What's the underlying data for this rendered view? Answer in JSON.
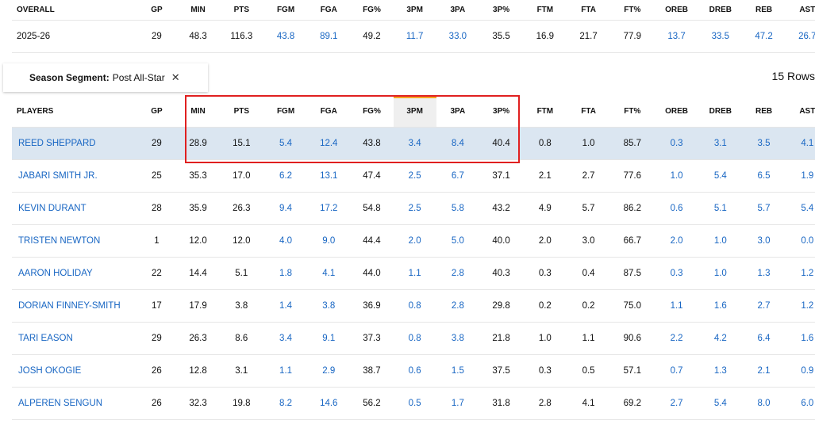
{
  "summary": {
    "headers": [
      "OVERALL",
      "GP",
      "MIN",
      "PTS",
      "FGM",
      "FGA",
      "FG%",
      "3PM",
      "3PA",
      "3P%",
      "FTM",
      "FTA",
      "FT%",
      "OREB",
      "DREB",
      "REB",
      "AST"
    ],
    "row": [
      "2025-26",
      "29",
      "48.3",
      "116.3",
      "43.8",
      "89.1",
      "49.2",
      "11.7",
      "33.0",
      "35.5",
      "16.9",
      "21.7",
      "77.9",
      "13.7",
      "33.5",
      "47.2",
      "26.7"
    ]
  },
  "segment": {
    "label": "Season Segment:",
    "value": "Post All-Star",
    "close": "✕"
  },
  "row_count": "15 Rows",
  "players": {
    "headers": [
      "PLAYERS",
      "GP",
      "MIN",
      "PTS",
      "FGM",
      "FGA",
      "FG%",
      "3PM",
      "3PA",
      "3P%",
      "FTM",
      "FTA",
      "FT%",
      "OREB",
      "DREB",
      "REB",
      "AST"
    ],
    "rows": [
      [
        "REED SHEPPARD",
        "29",
        "28.9",
        "15.1",
        "5.4",
        "12.4",
        "43.8",
        "3.4",
        "8.4",
        "40.4",
        "0.8",
        "1.0",
        "85.7",
        "0.3",
        "3.1",
        "3.5",
        "4.1"
      ],
      [
        "JABARI SMITH JR.",
        "25",
        "35.3",
        "17.0",
        "6.2",
        "13.1",
        "47.4",
        "2.5",
        "6.7",
        "37.1",
        "2.1",
        "2.7",
        "77.6",
        "1.0",
        "5.4",
        "6.5",
        "1.9"
      ],
      [
        "KEVIN DURANT",
        "28",
        "35.9",
        "26.3",
        "9.4",
        "17.2",
        "54.8",
        "2.5",
        "5.8",
        "43.2",
        "4.9",
        "5.7",
        "86.2",
        "0.6",
        "5.1",
        "5.7",
        "5.4"
      ],
      [
        "TRISTEN NEWTON",
        "1",
        "12.0",
        "12.0",
        "4.0",
        "9.0",
        "44.4",
        "2.0",
        "5.0",
        "40.0",
        "2.0",
        "3.0",
        "66.7",
        "2.0",
        "1.0",
        "3.0",
        "0.0"
      ],
      [
        "AARON HOLIDAY",
        "22",
        "14.4",
        "5.1",
        "1.8",
        "4.1",
        "44.0",
        "1.1",
        "2.8",
        "40.3",
        "0.3",
        "0.4",
        "87.5",
        "0.3",
        "1.0",
        "1.3",
        "1.2"
      ],
      [
        "DORIAN FINNEY-SMITH",
        "17",
        "17.9",
        "3.8",
        "1.4",
        "3.8",
        "36.9",
        "0.8",
        "2.8",
        "29.8",
        "0.2",
        "0.2",
        "75.0",
        "1.1",
        "1.6",
        "2.7",
        "1.2"
      ],
      [
        "TARI EASON",
        "29",
        "26.3",
        "8.6",
        "3.4",
        "9.1",
        "37.3",
        "0.8",
        "3.8",
        "21.8",
        "1.0",
        "1.1",
        "90.6",
        "2.2",
        "4.2",
        "6.4",
        "1.6"
      ],
      [
        "JOSH OKOGIE",
        "26",
        "12.8",
        "3.1",
        "1.1",
        "2.9",
        "38.7",
        "0.6",
        "1.5",
        "37.5",
        "0.3",
        "0.5",
        "57.1",
        "0.7",
        "1.3",
        "2.1",
        "0.9"
      ],
      [
        "ALPEREN SENGUN",
        "26",
        "32.3",
        "19.8",
        "8.2",
        "14.6",
        "56.2",
        "0.5",
        "1.7",
        "31.8",
        "2.8",
        "4.1",
        "69.2",
        "2.7",
        "5.4",
        "8.0",
        "6.0"
      ]
    ],
    "sorted_column": "3PM"
  },
  "colors": {
    "link": "#1866c3",
    "highlight_row": "#dbe6f1",
    "sort_indicator": "#f5a623",
    "annotation_box": "#e02020"
  }
}
